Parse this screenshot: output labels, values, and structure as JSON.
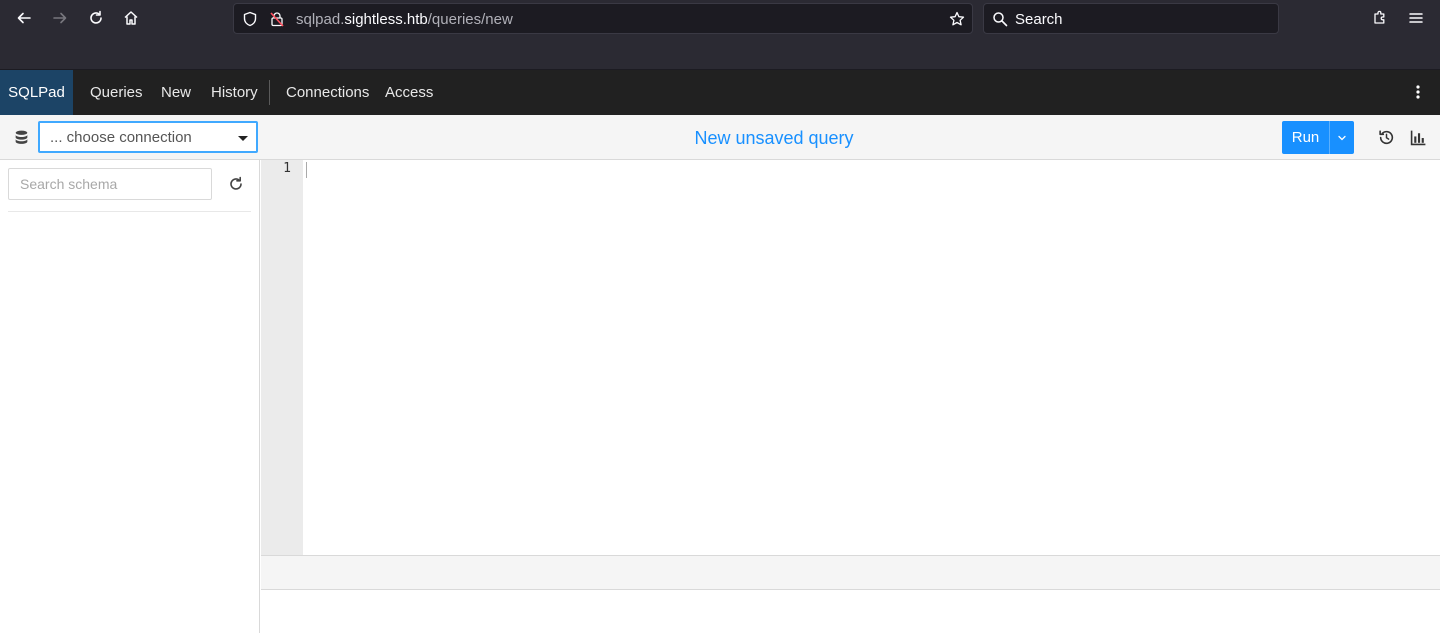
{
  "browser": {
    "url_prefix": "sqlpad.",
    "url_host": "sightless.htb",
    "url_path": "/queries/new",
    "search_placeholder": "Search"
  },
  "navbar": {
    "brand": "SQLPad",
    "links": [
      "Queries",
      "New",
      "History",
      "Connections",
      "Access"
    ]
  },
  "toolbar": {
    "connection_placeholder": "... choose connection",
    "query_title": "New unsaved query",
    "run_label": "Run"
  },
  "sidebar": {
    "search_placeholder": "Search schema"
  },
  "editor": {
    "line_numbers": [
      "1"
    ]
  },
  "colors": {
    "accent": "#1890ff",
    "brand_bg": "#1c4466",
    "navbar_bg": "#212121",
    "chrome_bg": "#2b2a33"
  }
}
